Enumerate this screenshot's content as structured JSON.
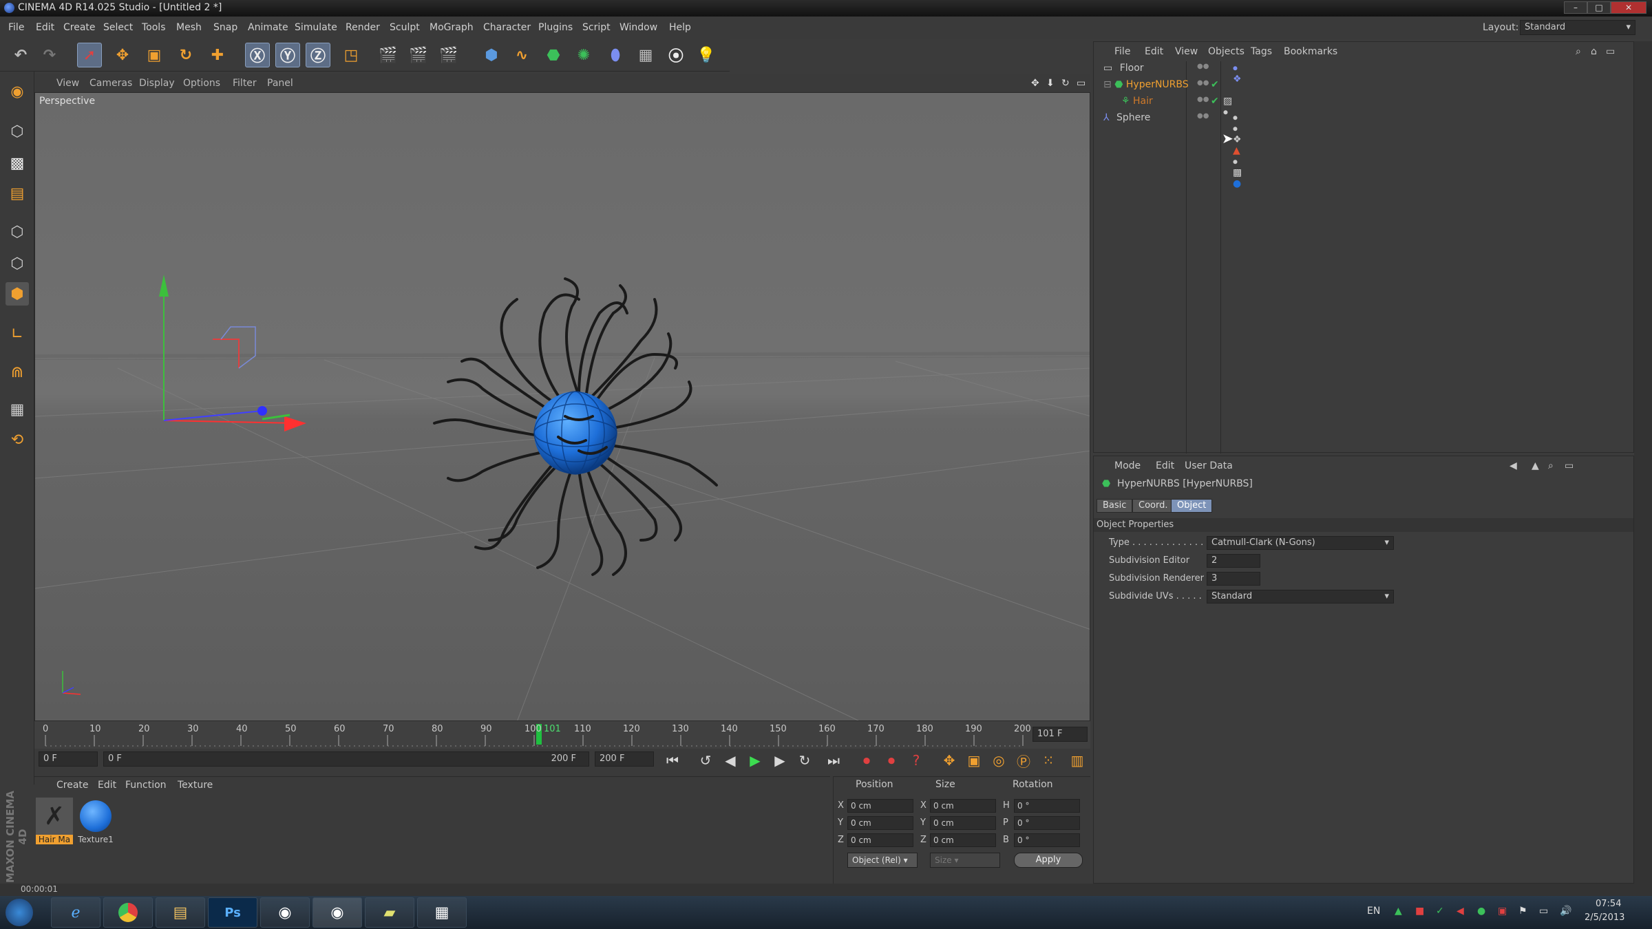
{
  "window": {
    "title": "CINEMA 4D R14.025 Studio - [Untitled 2 *]"
  },
  "menubar": [
    "File",
    "Edit",
    "Create",
    "Select",
    "Tools",
    "Mesh",
    "Snap",
    "Animate",
    "Simulate",
    "Render",
    "Sculpt",
    "MoGraph",
    "Character",
    "Plugins",
    "Script",
    "Window",
    "Help"
  ],
  "layout": {
    "label": "Layout:",
    "value": "Standard"
  },
  "viewport": {
    "menu": [
      "View",
      "Cameras",
      "Display",
      "Options",
      "Filter",
      "Panel"
    ],
    "label": "Perspective"
  },
  "timeline": {
    "ticks": [
      "0",
      "10",
      "20",
      "30",
      "40",
      "50",
      "60",
      "70",
      "80",
      "90",
      "100",
      "110",
      "120",
      "130",
      "140",
      "150",
      "160",
      "170",
      "180",
      "190",
      "200"
    ],
    "current_marker": "101",
    "end_field": "101 F",
    "start_field": "0 F",
    "range_start": "0 F",
    "range_end": "200 F",
    "max_field": "200 F"
  },
  "material_manager": {
    "menu": [
      "Create",
      "Edit",
      "Function",
      "Texture"
    ],
    "materials": [
      {
        "name": "Hair Ma",
        "kind": "hair"
      },
      {
        "name": "Texture1",
        "kind": "sphere"
      }
    ]
  },
  "coordinates": {
    "headers": [
      "Position",
      "Size",
      "Rotation"
    ],
    "rows": [
      {
        "axis": "X",
        "pos": "0 cm",
        "size_axis": "X",
        "size": "0 cm",
        "rot_axis": "H",
        "rot": "0 °"
      },
      {
        "axis": "Y",
        "pos": "0 cm",
        "size_axis": "Y",
        "size": "0 cm",
        "rot_axis": "P",
        "rot": "0 °"
      },
      {
        "axis": "Z",
        "pos": "0 cm",
        "size_axis": "Z",
        "size": "0 cm",
        "rot_axis": "B",
        "rot": "0 °"
      }
    ],
    "mode_select": "Object (Rel)",
    "size_select": "Size",
    "apply": "Apply"
  },
  "object_manager": {
    "menu": [
      "File",
      "Edit",
      "View",
      "Objects",
      "Tags",
      "Bookmarks"
    ],
    "objects": [
      {
        "name": "Floor",
        "color": "#c8c8c8"
      },
      {
        "name": "HyperNURBS",
        "color": "#f0a030"
      },
      {
        "name": "Hair",
        "color": "#d07a2a"
      },
      {
        "name": "Sphere",
        "color": "#c8c8c8"
      }
    ]
  },
  "attributes": {
    "menu": [
      "Mode",
      "Edit",
      "User Data"
    ],
    "object_title": "HyperNURBS [HyperNURBS]",
    "tabs": [
      "Basic",
      "Coord.",
      "Object"
    ],
    "section": "Object Properties",
    "props": [
      {
        "label": "Type . . . . . . . . . . . . .",
        "value": "Catmull-Clark (N-Gons)"
      },
      {
        "label": "Subdivision Editor",
        "value": "2"
      },
      {
        "label": "Subdivision Renderer",
        "value": "3"
      },
      {
        "label": "Subdivide UVs . . . . .",
        "value": "Standard"
      }
    ]
  },
  "status": {
    "time": "00:00:01"
  },
  "taskbar": {
    "lang": "EN",
    "clock_time": "07:54",
    "clock_date": "2/5/2013",
    "ps_label": "Ps"
  },
  "brand": {
    "vertical": "MAXON CINEMA 4D"
  },
  "colors": {
    "accent": "#7d93b8",
    "sphere": "#1e6fd9",
    "hair": "#1a1a1a"
  }
}
